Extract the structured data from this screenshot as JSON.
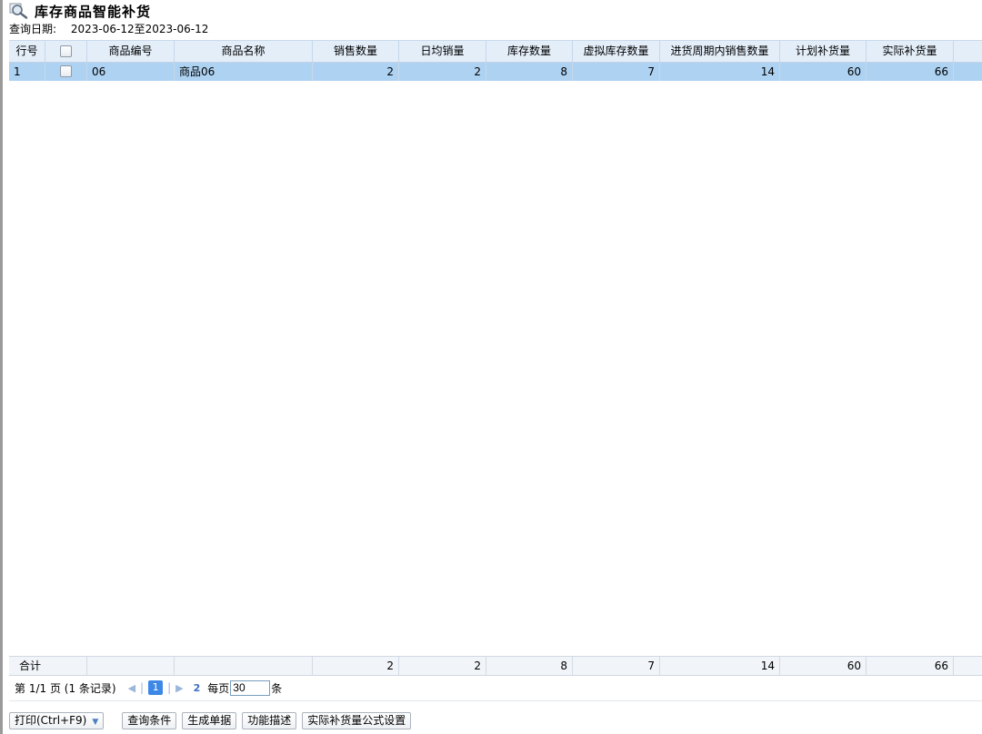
{
  "title": "库存商品智能补货",
  "query_date": {
    "label": "查询日期:",
    "value": "2023-06-12至2023-06-12"
  },
  "columns": [
    "行号",
    "",
    "商品编号",
    "商品名称",
    "销售数量",
    "日均销量",
    "库存数量",
    "虚拟库存数量",
    "进货周期内销售数量",
    "计划补货量",
    "实际补货量"
  ],
  "rows": [
    {
      "row_no": "1",
      "code": "06",
      "name": "商品06",
      "sales_qty": "2",
      "daily_avg": "2",
      "stock_qty": "8",
      "virtual_stock": "7",
      "period_sales": "14",
      "plan_qty": "60",
      "actual_qty": "66"
    }
  ],
  "totals": {
    "label": "合计",
    "sales_qty": "2",
    "daily_avg": "2",
    "stock_qty": "8",
    "virtual_stock": "7",
    "period_sales": "14",
    "plan_qty": "60",
    "actual_qty": "66"
  },
  "pager": {
    "info": "第 1/1 页 (1 条记录)",
    "current_page": "1",
    "next_page": "2",
    "per_page_label": "每页",
    "per_page_value": "30",
    "unit": "条"
  },
  "toolbar": {
    "print": "打印(Ctrl+F9)",
    "query_conditions": "查询条件",
    "generate_doc": "生成单据",
    "func_desc": "功能描述",
    "formula_settings": "实际补货量公式设置"
  },
  "colors": {
    "header_bg": "#e3eef9",
    "selected_row": "#aed2f2",
    "page_accent": "#3d88e6"
  }
}
